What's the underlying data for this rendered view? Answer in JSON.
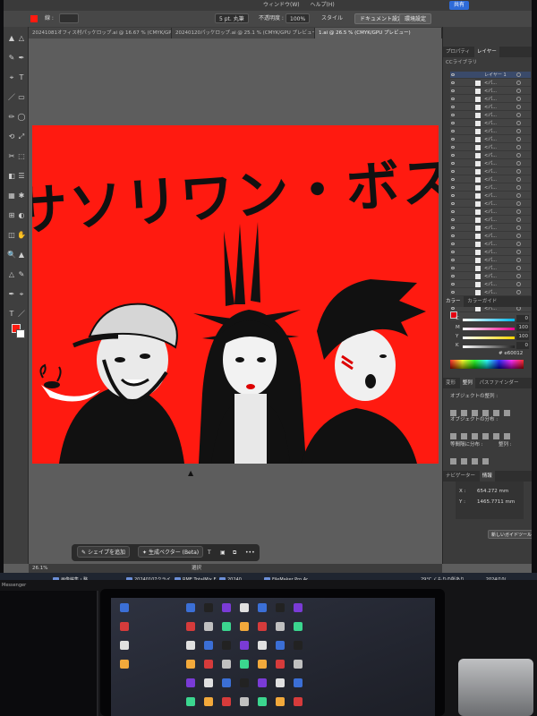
{
  "app": {
    "menu": [
      "ウィンドウ(W)",
      "ヘルプ(H)"
    ],
    "share_label": "共有",
    "control": {
      "stroke_style": "5 pt. 丸筆",
      "opacity_label": "不透明度 :",
      "opacity_value": "100%",
      "style_label": "スタイル",
      "doc_setup": "ドキュメント設定",
      "prefs": "環境設定",
      "weight_label": "線 :"
    },
    "tabs": [
      "20241081オフィス村パッケロップ.ai @ 16.67 % (CMYK/GPU プレビュー)",
      "20240120パッケロップ.ai @ 25.1 % (CMYK/GPU プレビュー)",
      "1.ai @ 26.5 % (CMYK/GPU プレビュー)"
    ],
    "zoom": "26.1%",
    "status_mode": "選択"
  },
  "artwork": {
    "title": "サソリワン・ボス",
    "bg_color": "#ff1a10",
    "ink_color": "#111111"
  },
  "panels": {
    "layers_tabs": [
      "プロパティ",
      "レイヤー",
      "CCライブラリ"
    ],
    "layer_header": "レイヤー 1",
    "layer_item": "<パ...",
    "layer_count": 30,
    "color_tabs": [
      "カラー",
      "カラーガイド"
    ],
    "color_channels": [
      {
        "ch": "C",
        "value": "0",
        "color": "#00b7eb"
      },
      {
        "ch": "M",
        "value": "100",
        "color": "#ec008c"
      },
      {
        "ch": "Y",
        "value": "100",
        "color": "#ffd400"
      },
      {
        "ch": "K",
        "value": "0",
        "color": "#222222"
      }
    ],
    "hex": "e60012",
    "transform_tabs": [
      "変形",
      "整列",
      "パスファインダー"
    ],
    "align_objects": "オブジェクトの整列 :",
    "distribute_objects": "オブジェクトの分布 :",
    "distribute_spacing": "等間隔に分布 :",
    "align_to": "整列 :",
    "nav_tabs": [
      "ナビゲーター",
      "情報"
    ],
    "x_label": "X :",
    "x_value": "654.272 mm",
    "y_label": "Y :",
    "y_value": "1465.7711 mm",
    "new_guide": "新しいガイドツール"
  },
  "task_bar": {
    "add_shape": "シェイプを追加",
    "gen_vector": "生成ベクター (Beta)",
    "more": "•••"
  },
  "windows": {
    "apps": [
      "画像編集・整...",
      "20240107クライヤ",
      "RME TotalMix FX 3...",
      "20240...",
      "FileMaker Pro Adv..."
    ],
    "weather": "29°C くもりの所あり",
    "clock": "2024/10/..."
  },
  "laptop_label": "Messenger"
}
